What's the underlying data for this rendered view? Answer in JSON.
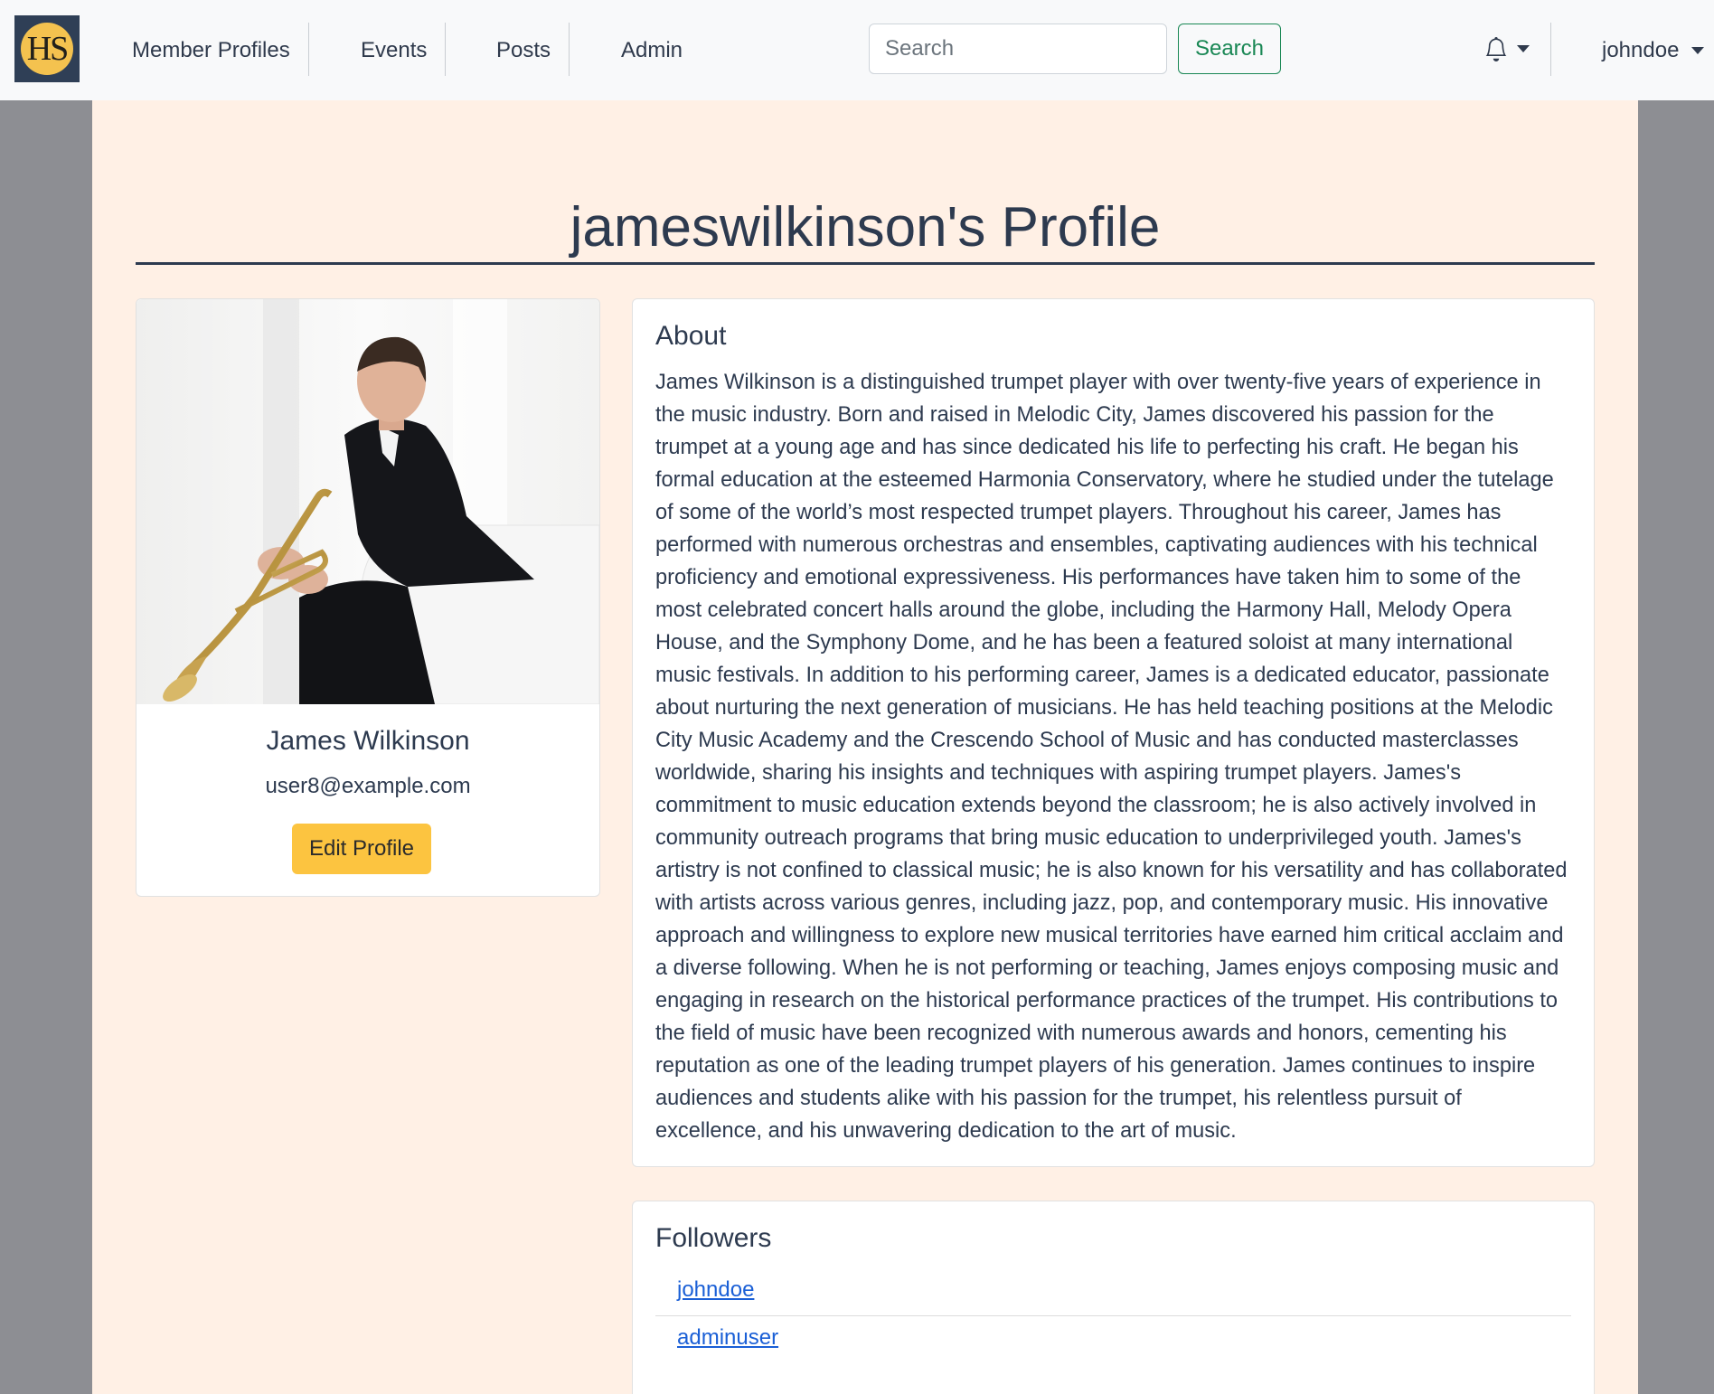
{
  "navbar": {
    "logo_text": "HS",
    "links": [
      "Member Profiles",
      "Events",
      "Posts",
      "Admin"
    ],
    "search_placeholder": "Search",
    "search_button": "Search",
    "user_menu": "johndoe"
  },
  "page": {
    "title": "jameswilkinson's Profile"
  },
  "profile": {
    "name": "James Wilkinson",
    "email": "user8@example.com",
    "edit_button": "Edit Profile"
  },
  "about": {
    "heading": "About",
    "text": "James Wilkinson is a distinguished trumpet player with over twenty-five years of experience in the music industry. Born and raised in Melodic City, James discovered his passion for the trumpet at a young age and has since dedicated his life to perfecting his craft. He began his formal education at the esteemed Harmonia Conservatory, where he studied under the tutelage of some of the world’s most respected trumpet players. Throughout his career, James has performed with numerous orchestras and ensembles, captivating audiences with his technical proficiency and emotional expressiveness. His performances have taken him to some of the most celebrated concert halls around the globe, including the Harmony Hall, Melody Opera House, and the Symphony Dome, and he has been a featured soloist at many international music festivals. In addition to his performing career, James is a dedicated educator, passionate about nurturing the next generation of musicians. He has held teaching positions at the Melodic City Music Academy and the Crescendo School of Music and has conducted masterclasses worldwide, sharing his insights and techniques with aspiring trumpet players. James's commitment to music education extends beyond the classroom; he is also actively involved in community outreach programs that bring music education to underprivileged youth. James's artistry is not confined to classical music; he is also known for his versatility and has collaborated with artists across various genres, including jazz, pop, and contemporary music. His innovative approach and willingness to explore new musical territories have earned him critical acclaim and a diverse following. When he is not performing or teaching, James enjoys composing music and engaging in research on the historical performance practices of the trumpet. His contributions to the field of music have been recognized with numerous awards and honors, cementing his reputation as one of the leading trumpet players of his generation. James continues to inspire audiences and students alike with his passion for the trumpet, his relentless pursuit of excellence, and his unwavering dedication to the art of music."
  },
  "followers": {
    "heading": "Followers",
    "items": [
      "johndoe",
      "adminuser"
    ]
  },
  "colors": {
    "page_background": "#fff0e5",
    "outer_background": "#8d8e93",
    "navbar_background": "#f8f9fa",
    "logo_tile": "#2f3f56",
    "logo_circle": "#f4c24f",
    "search_accent": "#198754",
    "edit_button": "#fcc440",
    "link": "#1a5fd6"
  },
  "icons": {
    "notifications": "bell-icon",
    "dropdown": "caret-down-icon"
  }
}
